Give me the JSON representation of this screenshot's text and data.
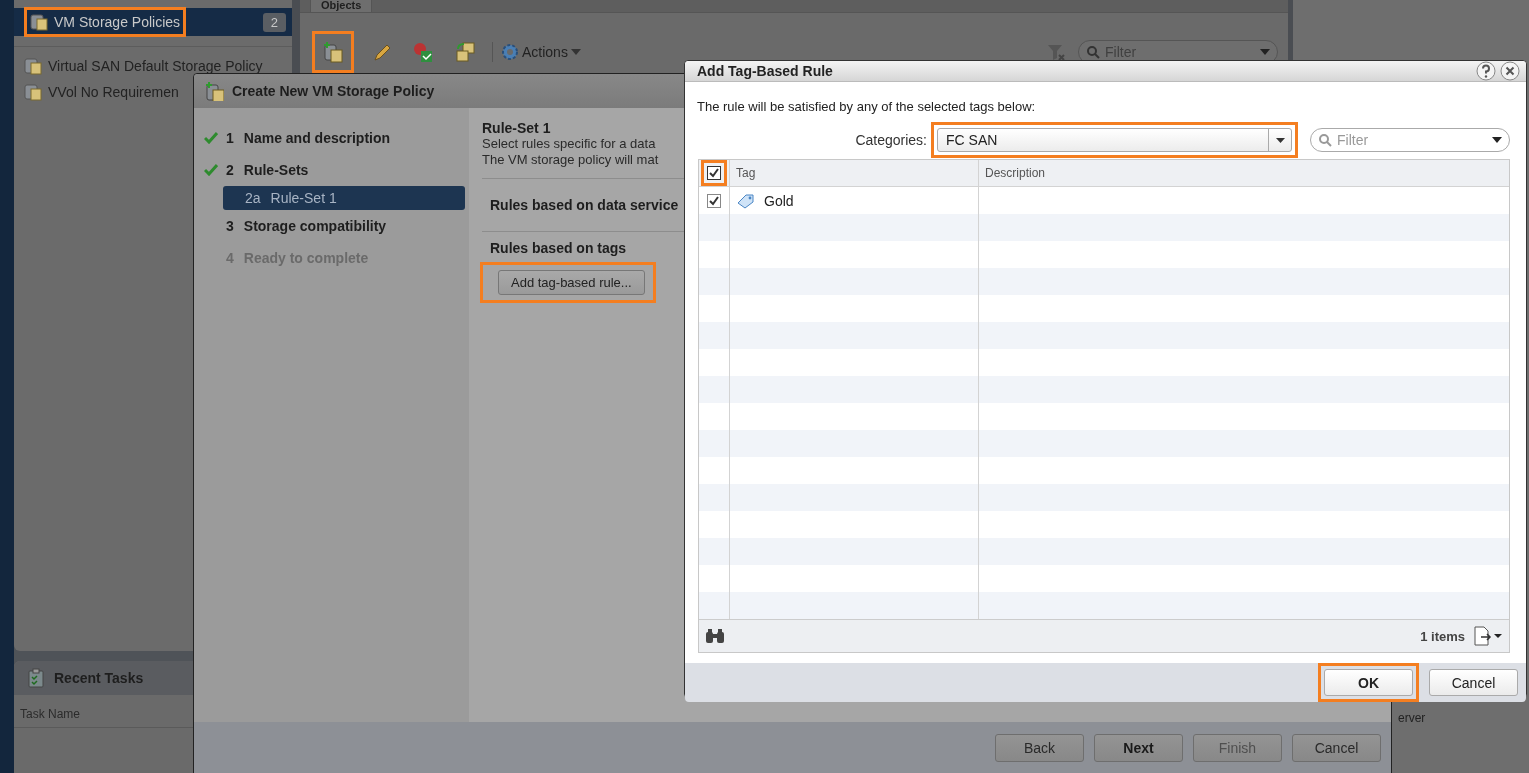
{
  "sidebar": {
    "items": [
      {
        "label": "VM Storage Policies",
        "count": "2",
        "selected": true,
        "highlighted": true
      }
    ],
    "policies": [
      "Virtual SAN Default Storage Policy",
      "VVol No Requiremen"
    ]
  },
  "recent_tasks": {
    "title": "Recent Tasks",
    "columns": [
      "Task Name"
    ]
  },
  "main": {
    "tabs": [
      {
        "label": "Objects",
        "selected": true
      }
    ],
    "toolbar": [
      {
        "kind": "create",
        "highlighted": true
      },
      {
        "kind": "edit",
        "highlighted": false
      },
      {
        "kind": "check",
        "highlighted": false
      },
      {
        "kind": "clone",
        "highlighted": false
      }
    ],
    "actions": "Actions",
    "filter_placeholder": "Filter"
  },
  "right_panel": {
    "column_text": "erver"
  },
  "wizard": {
    "title": "Create New VM Storage Policy",
    "steps": [
      {
        "number": "1",
        "label": "Name and description",
        "done": true,
        "disabled": false,
        "selected": false
      },
      {
        "number": "2",
        "label": "Rule-Sets",
        "done": true,
        "disabled": false,
        "selected": false,
        "children": [
          {
            "number": "2a",
            "label": "Rule-Set 1",
            "done": false,
            "disabled": false,
            "selected": true
          }
        ]
      },
      {
        "number": "3",
        "label": "Storage compatibility",
        "done": false,
        "disabled": false,
        "selected": false
      },
      {
        "number": "4",
        "label": "Ready to complete",
        "done": false,
        "disabled": true,
        "selected": false
      }
    ],
    "heading": "Rule-Set 1",
    "description": [
      "Select rules specific for a data",
      "The VM storage policy will mat"
    ],
    "sections": [
      {
        "title": "Rules based on data service"
      },
      {
        "title": "Rules based on tags",
        "button": "Add tag-based rule...",
        "highlighted": true
      }
    ],
    "buttons": [
      {
        "label": "Back",
        "kind": "normal"
      },
      {
        "label": "Next",
        "kind": "primary"
      },
      {
        "label": "Finish",
        "kind": "disabled"
      },
      {
        "label": "Cancel",
        "kind": "normal"
      }
    ]
  },
  "tag_dialog": {
    "title": "Add Tag-Based Rule",
    "instruction": "The rule will be satisfied by any of the selected tags below:",
    "categories_label": "Categories:",
    "category": "FC SAN",
    "category_highlighted": true,
    "filter_placeholder": "Filter",
    "columns": [
      "Tag",
      "Description"
    ],
    "header_checked": true,
    "header_highlighted": true,
    "rows": [
      {
        "tag": "Gold",
        "checked": true
      }
    ],
    "count": "1 items",
    "buttons": [
      {
        "label": "OK",
        "kind": "primary",
        "highlighted": true
      },
      {
        "label": "Cancel",
        "kind": "normal",
        "highlighted": false
      }
    ]
  }
}
